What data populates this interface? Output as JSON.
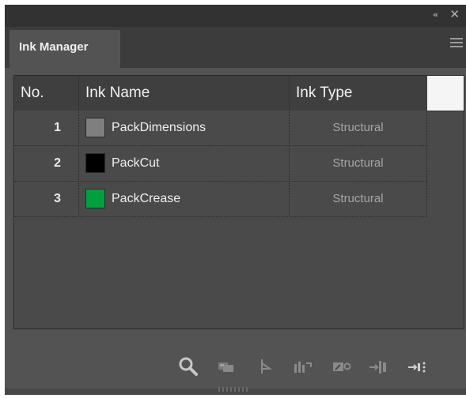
{
  "window": {
    "collapse_glyph": "«",
    "close_glyph": "✕"
  },
  "tab": {
    "title": "Ink Manager"
  },
  "table": {
    "headers": {
      "no": "No.",
      "name": "Ink Name",
      "type": "Ink Type"
    },
    "rows": [
      {
        "no": "1",
        "name": "PackDimensions",
        "type": "Structural",
        "color": "#7f7f7f"
      },
      {
        "no": "2",
        "name": "PackCut",
        "type": "Structural",
        "color": "#000000"
      },
      {
        "no": "3",
        "name": "PackCrease",
        "type": "Structural",
        "color": "#00a040"
      }
    ]
  },
  "toolbar": {
    "icons": [
      "search-icon",
      "ink-reassign-icon",
      "ink-create-icon",
      "ink-merge-icon",
      "ink-edit-icon",
      "ink-import-icon",
      "ink-export-icon"
    ]
  }
}
